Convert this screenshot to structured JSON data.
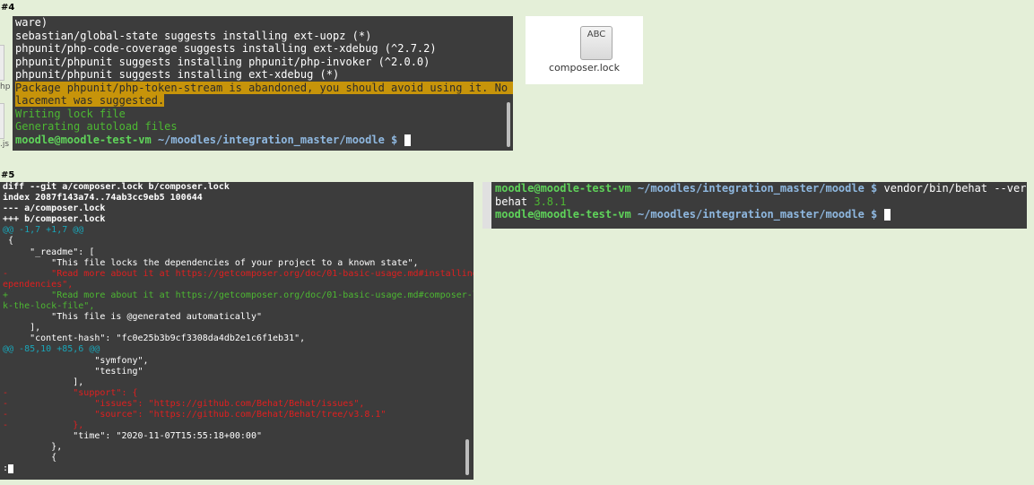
{
  "labels": {
    "step4": "#4",
    "step5": "#5"
  },
  "desktop": {
    "left_fragment_1": "hp",
    "left_fragment_2": ".js"
  },
  "file_icon": {
    "glyph": "ABC",
    "name": "composer.lock"
  },
  "terminal_install": {
    "lines": [
      "ware)",
      "sebastian/global-state suggests installing ext-uopz (*)",
      "phpunit/php-code-coverage suggests installing ext-xdebug (^2.7.2)",
      "phpunit/phpunit suggests installing phpunit/php-invoker (^2.0.0)",
      "phpunit/phpunit suggests installing ext-xdebug (*)"
    ],
    "warning_lines": [
      "Package phpunit/php-token-stream is abandoned, you should avoid using it. No rep",
      "lacement was suggested."
    ],
    "status_lines": [
      "Writing lock file",
      "Generating autoload files"
    ],
    "prompt_user": "moodle@moodle-test-vm",
    "prompt_path": "~/moodles/integration_master/moodle $"
  },
  "terminal_diff": {
    "header": [
      "diff --git a/composer.lock b/composer.lock",
      "index 2087f143a74..74ab3cc9eb5 100644",
      "--- a/composer.lock",
      "+++ b/composer.lock"
    ],
    "hunk1": "@@ -1,7 +1,7 @@",
    "context1": [
      " {",
      "     \"_readme\": [",
      "         \"This file locks the dependencies of your project to a known state\","
    ],
    "removed1": [
      "-        \"Read more about it at https://getcomposer.org/doc/01-basic-usage.md#installing-d",
      "ependencies\","
    ],
    "added1": [
      "+        \"Read more about it at https://getcomposer.org/doc/01-basic-usage.md#composer-loc",
      "k-the-lock-file\","
    ],
    "context2": [
      "         \"This file is @generated automatically\"",
      "     ],",
      "     \"content-hash\": \"fc0e25b3b9cf3308da4db2e1c6f1eb31\","
    ],
    "hunk2": "@@ -85,10 +85,6 @@",
    "context3": [
      "                 \"symfony\",",
      "                 \"testing\"",
      "             ],"
    ],
    "removed2": [
      "-            \"support\": {",
      "-                \"issues\": \"https://github.com/Behat/Behat/issues\",",
      "-                \"source\": \"https://github.com/Behat/Behat/tree/v3.8.1\"",
      "-            },"
    ],
    "context4": [
      "             \"time\": \"2020-11-07T15:55:18+00:00\"",
      "         },",
      "         {"
    ],
    "pager_prompt": ":"
  },
  "terminal_version": {
    "prompt_user": "moodle@moodle-test-vm",
    "prompt_path": "~/moodles/integration_master/moodle $",
    "command": "vendor/bin/behat --version",
    "output_name": "behat",
    "output_version": "3.8.1"
  }
}
